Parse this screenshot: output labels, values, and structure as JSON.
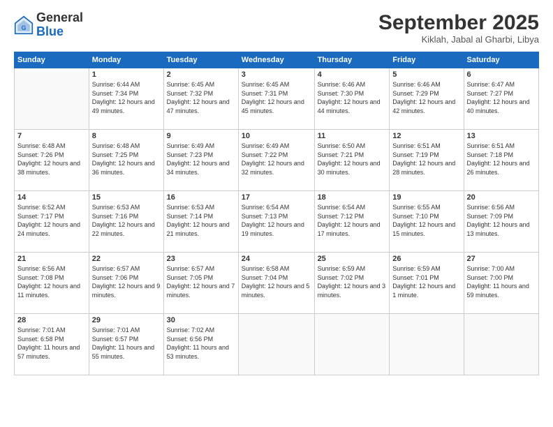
{
  "header": {
    "logo_general": "General",
    "logo_blue": "Blue",
    "month_title": "September 2025",
    "location": "Kiklah, Jabal al Gharbi, Libya"
  },
  "weekdays": [
    "Sunday",
    "Monday",
    "Tuesday",
    "Wednesday",
    "Thursday",
    "Friday",
    "Saturday"
  ],
  "weeks": [
    [
      {
        "day": "",
        "sunrise": "",
        "sunset": "",
        "daylight": ""
      },
      {
        "day": "1",
        "sunrise": "6:44 AM",
        "sunset": "7:34 PM",
        "daylight": "12 hours and 49 minutes."
      },
      {
        "day": "2",
        "sunrise": "6:45 AM",
        "sunset": "7:32 PM",
        "daylight": "12 hours and 47 minutes."
      },
      {
        "day": "3",
        "sunrise": "6:45 AM",
        "sunset": "7:31 PM",
        "daylight": "12 hours and 45 minutes."
      },
      {
        "day": "4",
        "sunrise": "6:46 AM",
        "sunset": "7:30 PM",
        "daylight": "12 hours and 44 minutes."
      },
      {
        "day": "5",
        "sunrise": "6:46 AM",
        "sunset": "7:29 PM",
        "daylight": "12 hours and 42 minutes."
      },
      {
        "day": "6",
        "sunrise": "6:47 AM",
        "sunset": "7:27 PM",
        "daylight": "12 hours and 40 minutes."
      }
    ],
    [
      {
        "day": "7",
        "sunrise": "6:48 AM",
        "sunset": "7:26 PM",
        "daylight": "12 hours and 38 minutes."
      },
      {
        "day": "8",
        "sunrise": "6:48 AM",
        "sunset": "7:25 PM",
        "daylight": "12 hours and 36 minutes."
      },
      {
        "day": "9",
        "sunrise": "6:49 AM",
        "sunset": "7:23 PM",
        "daylight": "12 hours and 34 minutes."
      },
      {
        "day": "10",
        "sunrise": "6:49 AM",
        "sunset": "7:22 PM",
        "daylight": "12 hours and 32 minutes."
      },
      {
        "day": "11",
        "sunrise": "6:50 AM",
        "sunset": "7:21 PM",
        "daylight": "12 hours and 30 minutes."
      },
      {
        "day": "12",
        "sunrise": "6:51 AM",
        "sunset": "7:19 PM",
        "daylight": "12 hours and 28 minutes."
      },
      {
        "day": "13",
        "sunrise": "6:51 AM",
        "sunset": "7:18 PM",
        "daylight": "12 hours and 26 minutes."
      }
    ],
    [
      {
        "day": "14",
        "sunrise": "6:52 AM",
        "sunset": "7:17 PM",
        "daylight": "12 hours and 24 minutes."
      },
      {
        "day": "15",
        "sunrise": "6:53 AM",
        "sunset": "7:16 PM",
        "daylight": "12 hours and 22 minutes."
      },
      {
        "day": "16",
        "sunrise": "6:53 AM",
        "sunset": "7:14 PM",
        "daylight": "12 hours and 21 minutes."
      },
      {
        "day": "17",
        "sunrise": "6:54 AM",
        "sunset": "7:13 PM",
        "daylight": "12 hours and 19 minutes."
      },
      {
        "day": "18",
        "sunrise": "6:54 AM",
        "sunset": "7:12 PM",
        "daylight": "12 hours and 17 minutes."
      },
      {
        "day": "19",
        "sunrise": "6:55 AM",
        "sunset": "7:10 PM",
        "daylight": "12 hours and 15 minutes."
      },
      {
        "day": "20",
        "sunrise": "6:56 AM",
        "sunset": "7:09 PM",
        "daylight": "12 hours and 13 minutes."
      }
    ],
    [
      {
        "day": "21",
        "sunrise": "6:56 AM",
        "sunset": "7:08 PM",
        "daylight": "12 hours and 11 minutes."
      },
      {
        "day": "22",
        "sunrise": "6:57 AM",
        "sunset": "7:06 PM",
        "daylight": "12 hours and 9 minutes."
      },
      {
        "day": "23",
        "sunrise": "6:57 AM",
        "sunset": "7:05 PM",
        "daylight": "12 hours and 7 minutes."
      },
      {
        "day": "24",
        "sunrise": "6:58 AM",
        "sunset": "7:04 PM",
        "daylight": "12 hours and 5 minutes."
      },
      {
        "day": "25",
        "sunrise": "6:59 AM",
        "sunset": "7:02 PM",
        "daylight": "12 hours and 3 minutes."
      },
      {
        "day": "26",
        "sunrise": "6:59 AM",
        "sunset": "7:01 PM",
        "daylight": "12 hours and 1 minute."
      },
      {
        "day": "27",
        "sunrise": "7:00 AM",
        "sunset": "7:00 PM",
        "daylight": "11 hours and 59 minutes."
      }
    ],
    [
      {
        "day": "28",
        "sunrise": "7:01 AM",
        "sunset": "6:58 PM",
        "daylight": "11 hours and 57 minutes."
      },
      {
        "day": "29",
        "sunrise": "7:01 AM",
        "sunset": "6:57 PM",
        "daylight": "11 hours and 55 minutes."
      },
      {
        "day": "30",
        "sunrise": "7:02 AM",
        "sunset": "6:56 PM",
        "daylight": "11 hours and 53 minutes."
      },
      {
        "day": "",
        "sunrise": "",
        "sunset": "",
        "daylight": ""
      },
      {
        "day": "",
        "sunrise": "",
        "sunset": "",
        "daylight": ""
      },
      {
        "day": "",
        "sunrise": "",
        "sunset": "",
        "daylight": ""
      },
      {
        "day": "",
        "sunrise": "",
        "sunset": "",
        "daylight": ""
      }
    ]
  ]
}
